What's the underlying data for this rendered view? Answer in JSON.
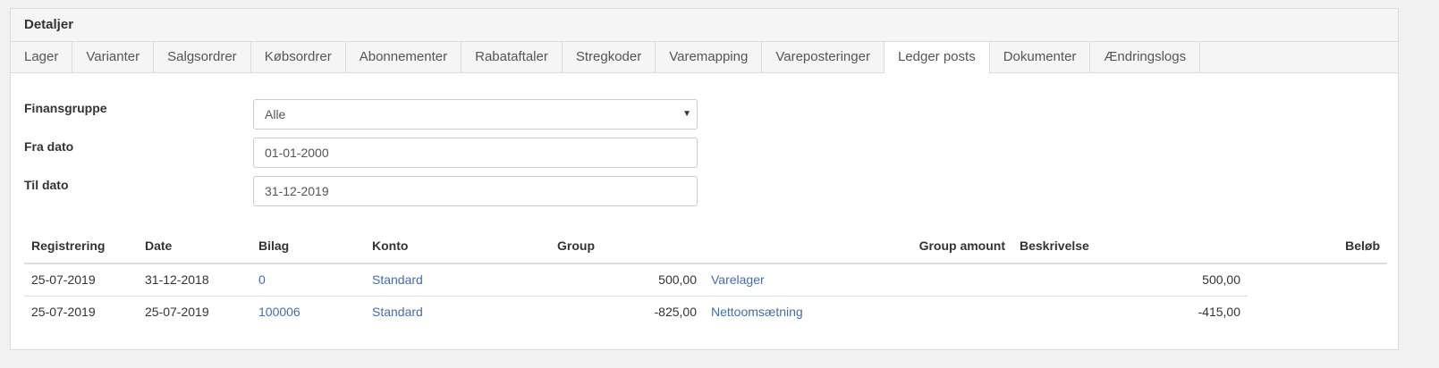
{
  "panel": {
    "title": "Detaljer"
  },
  "tabs": [
    {
      "label": "Lager",
      "active": false
    },
    {
      "label": "Varianter",
      "active": false
    },
    {
      "label": "Salgsordrer",
      "active": false
    },
    {
      "label": "Købsordrer",
      "active": false
    },
    {
      "label": "Abonnementer",
      "active": false
    },
    {
      "label": "Rabataftaler",
      "active": false
    },
    {
      "label": "Stregkoder",
      "active": false
    },
    {
      "label": "Varemapping",
      "active": false
    },
    {
      "label": "Vareposteringer",
      "active": false
    },
    {
      "label": "Ledger posts",
      "active": true
    },
    {
      "label": "Dokumenter",
      "active": false
    },
    {
      "label": "Ændringslogs",
      "active": false
    }
  ],
  "filters": {
    "finansgruppe": {
      "label": "Finansgruppe",
      "value": "Alle"
    },
    "fra_dato": {
      "label": "Fra dato",
      "value": "01-01-2000"
    },
    "til_dato": {
      "label": "Til dato",
      "value": "31-12-2019"
    }
  },
  "table": {
    "headers": {
      "registrering": "Registrering",
      "date": "Date",
      "bilag": "Bilag",
      "konto": "Konto",
      "group": "Group",
      "group_amount": "Group amount",
      "beskrivelse": "Beskrivelse",
      "belob": "Beløb"
    },
    "rows": [
      {
        "registrering": "25-07-2019",
        "date": "31-12-2018",
        "bilag": "0",
        "konto": "Standard",
        "group_value": "500,00",
        "group_account": "Varelager",
        "group_amount": "500,00"
      },
      {
        "registrering": "25-07-2019",
        "date": "25-07-2019",
        "bilag": "100006",
        "konto": "Standard",
        "group_value": "-825,00",
        "group_account": "Nettoomsætning",
        "group_amount": "-415,00"
      }
    ]
  },
  "colors": {
    "link": "#3f6eb0",
    "border": "#dddddd"
  }
}
